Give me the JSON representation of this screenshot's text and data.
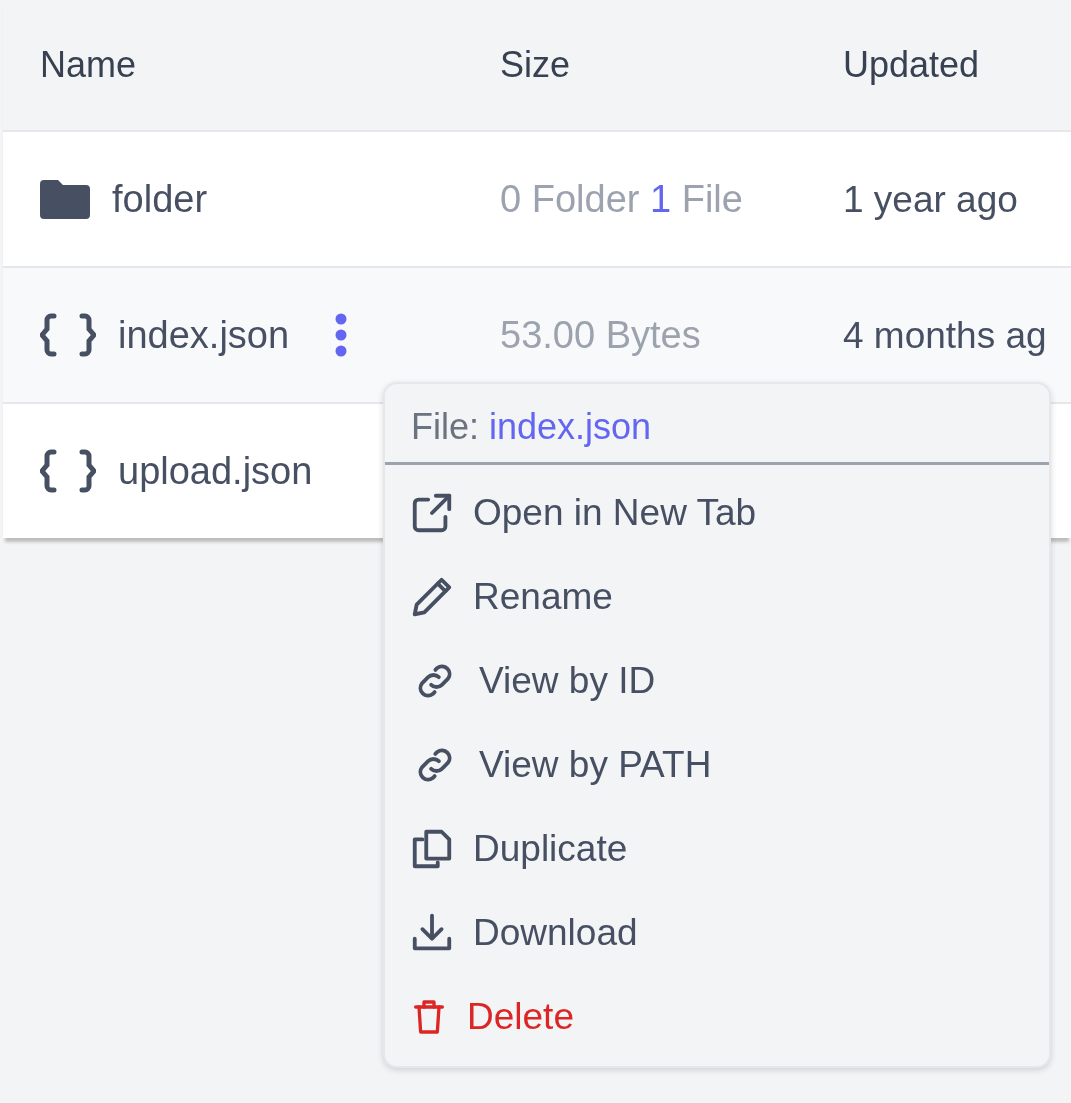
{
  "table": {
    "columns": [
      "Name",
      "Size",
      "Updated"
    ],
    "rows": [
      {
        "kind": "folder",
        "name": "folder",
        "size": {
          "folders": "0",
          "folder_label": "Folder",
          "files": "1",
          "file_label": "File"
        },
        "updated": "1 year ago",
        "selected": false
      },
      {
        "kind": "file",
        "name": "index.json",
        "size_text": "53.00 Bytes",
        "updated": "4 months ag",
        "selected": true
      },
      {
        "kind": "file",
        "name": "upload.json",
        "selected": false
      }
    ]
  },
  "context_menu": {
    "label": "File:",
    "file_name": "index.json",
    "items": [
      {
        "label": "Open in New Tab",
        "kind": "normal"
      },
      {
        "label": "Rename",
        "kind": "normal"
      },
      {
        "label": "View by ID",
        "kind": "normal"
      },
      {
        "label": "View by PATH",
        "kind": "normal"
      },
      {
        "label": "Duplicate",
        "kind": "normal"
      },
      {
        "label": "Download",
        "kind": "normal"
      },
      {
        "label": "Delete",
        "kind": "danger"
      }
    ]
  }
}
